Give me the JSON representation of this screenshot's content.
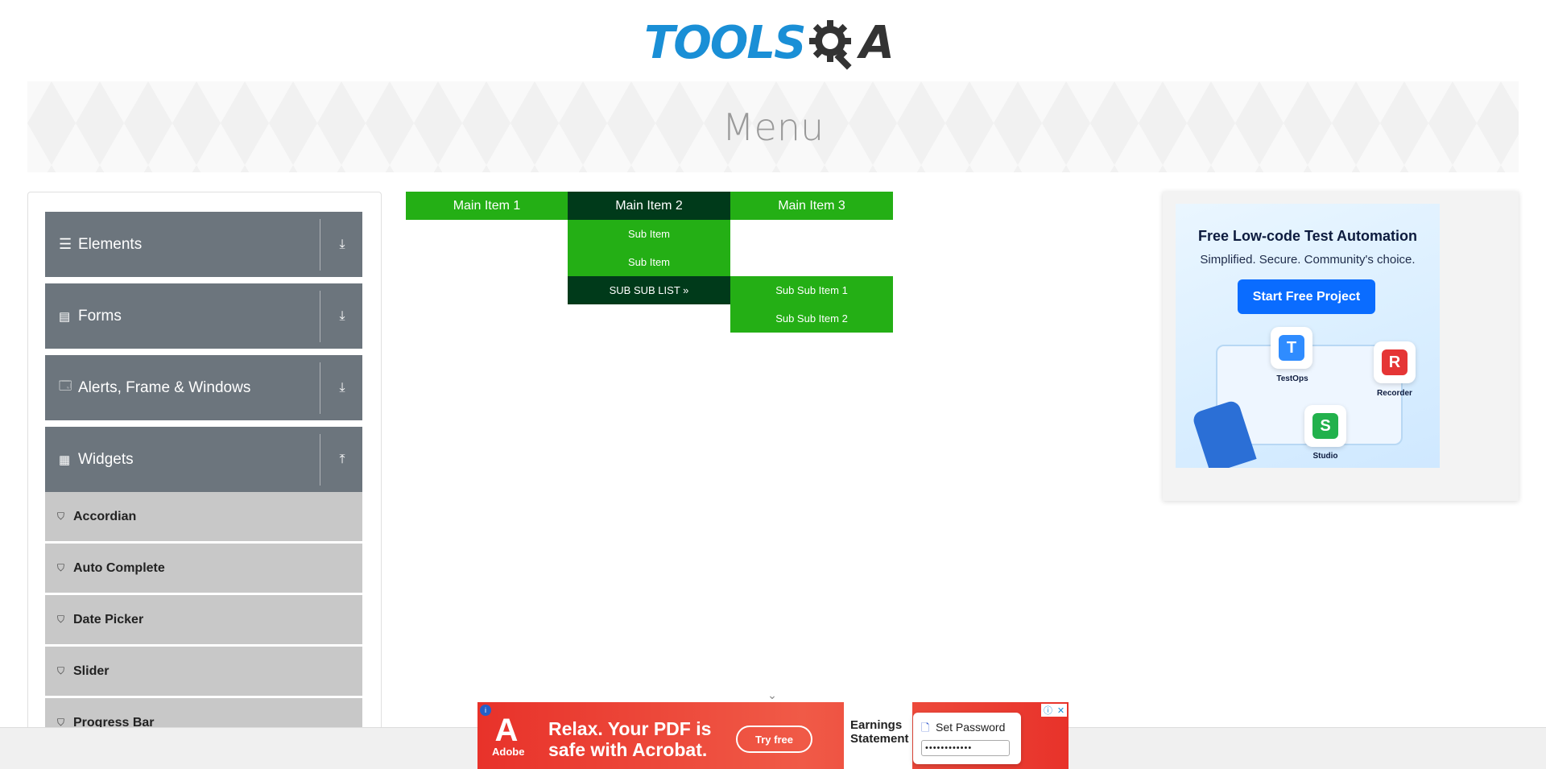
{
  "logo": {
    "text": "TOOLS",
    "suffix": "A"
  },
  "banner": {
    "title": "Menu"
  },
  "sidebar": {
    "groups": [
      {
        "label": "Elements",
        "icon": "hamburger-icon",
        "toggle": "download-arrow-icon"
      },
      {
        "label": "Forms",
        "icon": "document-icon",
        "toggle": "download-arrow-icon"
      },
      {
        "label": "Alerts, Frame & Windows",
        "icon": "window-icon",
        "toggle": "download-arrow-icon"
      },
      {
        "label": "Widgets",
        "icon": "grid-icon",
        "toggle": "upload-arrow-icon"
      }
    ],
    "items": [
      {
        "label": "Accordian",
        "icon": "html5-icon"
      },
      {
        "label": "Auto Complete",
        "icon": "html5-icon"
      },
      {
        "label": "Date Picker",
        "icon": "html5-icon"
      },
      {
        "label": "Slider",
        "icon": "html5-icon"
      },
      {
        "label": "Progress Bar",
        "icon": "html5-icon"
      }
    ]
  },
  "menu": {
    "main": [
      "Main Item 1",
      "Main Item 2",
      "Main Item 3"
    ],
    "sub": [
      "Sub Item",
      "Sub Item",
      "SUB SUB LIST »"
    ],
    "subsub": [
      "Sub Sub Item 1",
      "Sub Sub Item 2"
    ],
    "colors": {
      "item": "#24af15",
      "active": "#003a1a"
    }
  },
  "ad_right": {
    "title": "Free Low-code Test Automation",
    "subtitle": "Simplified. Secure. Community's choice.",
    "button": "Start Free Project",
    "tiles": [
      {
        "label": "TestOps",
        "letter": "T",
        "color": "#2f8cff"
      },
      {
        "label": "Recorder",
        "letter": "R",
        "color": "#e53535"
      },
      {
        "label": "Studio",
        "letter": "S",
        "color": "#22b14c"
      }
    ]
  },
  "ad_bottom": {
    "brand": "Adobe",
    "headline": "Relax. Your PDF is safe with Acrobat.",
    "cta": "Try free",
    "doc_title": "Earnings Statement",
    "password_title": "Set Password",
    "password_value": "••••••••••••"
  }
}
